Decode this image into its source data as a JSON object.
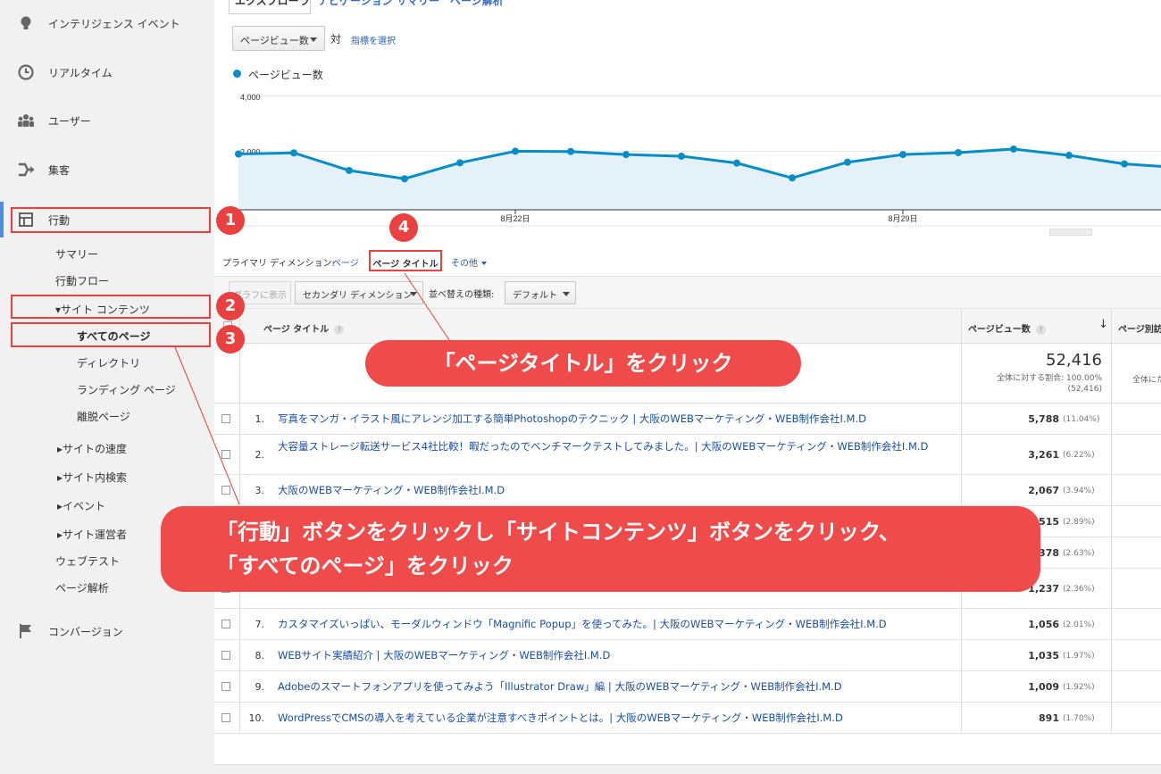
{
  "sidebar": {
    "intelligence": "インテリジェンス イベント",
    "realtime": "リアルタイム",
    "users": "ユーザー",
    "acquisition": "集客",
    "behavior": "行動",
    "summary": "サマリー",
    "flow": "行動フロー",
    "site_content": "▾サイト コンテンツ",
    "all_pages": "すべてのページ",
    "directory": "ディレクトリ",
    "landing": "ランディング ページ",
    "exit": "離脱ページ",
    "site_speed": "▸サイトの速度",
    "site_search": "▸サイト内検索",
    "events": "▸イベント",
    "publisher": "▸サイト運営者",
    "web_test": "ウェブテスト",
    "page_analysis": "ページ解析",
    "conversions": "コンバージョン"
  },
  "tabs": {
    "explorer": "エクスプローラ",
    "other": "ナビゲーション サマリー　ページ解析"
  },
  "chart_controls": {
    "metric": "ページビュー数",
    "vs": "対",
    "choose_metric": "指標を選択",
    "legend": "ページビュー数"
  },
  "chart_data": {
    "type": "line",
    "series": [
      {
        "name": "ページビュー数",
        "values": [
          1900,
          1940,
          1300,
          1000,
          1580,
          2000,
          1990,
          1880,
          1820,
          1570,
          1030,
          1600,
          1880,
          1950,
          2080,
          1850,
          1540,
          1400
        ]
      }
    ],
    "y_ticks": [
      "4,000",
      "2,000"
    ],
    "x_ticks": [
      "8月22日",
      "8月29日"
    ],
    "ylim": [
      0,
      4000
    ],
    "color": "#058dc7"
  },
  "primary_dimension": {
    "label": "プライマリ ディメンション:",
    "page": "ページ",
    "page_title": "ページ タイトル",
    "other": "その他"
  },
  "toolbar": {
    "graph": "グラフに表示",
    "secondary": "セカンダリ ディメンション",
    "sort_label": "並べ替えの種類:",
    "sort": "デフォルト"
  },
  "table": {
    "col_page_title": "ページ タイトル",
    "col_pageviews": "ページビュー数",
    "col_next": "ページ別訪",
    "total": "52,416",
    "total_pct": "全体に対する割合: 100.00%",
    "total_abs": "(52,416)",
    "total_next": "全体にた",
    "rows": [
      {
        "num": "1.",
        "title": "写真をマンガ・イラスト風にアレンジ加工する簡単Photoshopのテクニック | 大阪のWEBマーケティング・WEB制作会社I.M.D",
        "pv": "5,788",
        "pct": "(11.04%)"
      },
      {
        "num": "2.",
        "title": "大容量ストレージ転送サービス4社比較！暇だったのでベンチマークテストしてみました。| 大阪のWEBマーケティング・WEB制作会社I.M.D",
        "pv": "3,261",
        "pct": "(6.22%)"
      },
      {
        "num": "3.",
        "title": "大阪のWEBマーケティング・WEB制作会社I.M.D",
        "pv": "2,067",
        "pct": "(3.94%)"
      },
      {
        "num": "4.",
        "title": "",
        "pv": "1,515",
        "pct": "(2.89%)"
      },
      {
        "num": "5.",
        "title": "",
        "pv": "1,378",
        "pct": "(2.63%)"
      },
      {
        "num": "6.",
        "title": "グ・WEB制作会社I.M.D",
        "pv": "1,237",
        "pct": "(2.36%)"
      },
      {
        "num": "7.",
        "title": "カスタマイズいっぱい、モーダルウィンドウ「Magnific Popup」を使ってみた。| 大阪のWEBマーケティング・WEB制作会社I.M.D",
        "pv": "1,056",
        "pct": "(2.01%)"
      },
      {
        "num": "8.",
        "title": "WEBサイト実績紹介 | 大阪のWEBマーケティング・WEB制作会社I.M.D",
        "pv": "1,035",
        "pct": "(1.97%)"
      },
      {
        "num": "9.",
        "title": "Adobeのスマートフォンアプリを使ってみよう「Illustrator Draw」編 | 大阪のWEBマーケティング・WEB制作会社I.M.D",
        "pv": "1,009",
        "pct": "(1.92%)"
      },
      {
        "num": "10.",
        "title": "WordPressでCMSの導入を考えている企業が注意すべきポイントとは。| 大阪のWEBマーケティング・WEB制作会社I.M.D",
        "pv": "891",
        "pct": "(1.70%)"
      }
    ]
  },
  "annotations": {
    "badge1": "1",
    "badge2": "2",
    "badge3": "3",
    "badge4": "4",
    "callout_page_title": "「ページタイトル」をクリック",
    "callout_main_line1": "「行動」ボタンをクリックし「サイトコンテンツ」ボタンをクリック、",
    "callout_main_line2": "「すべてのページ」をクリック"
  }
}
